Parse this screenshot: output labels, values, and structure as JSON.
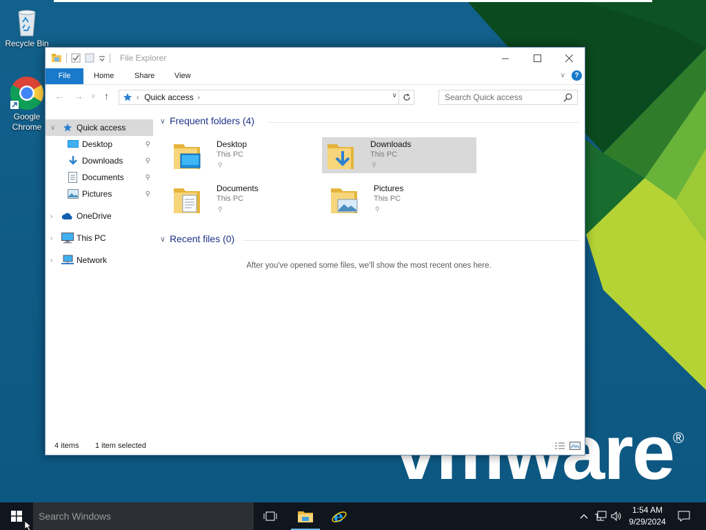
{
  "desktop": {
    "icons": [
      {
        "name": "recycle-bin",
        "label": "Recycle Bin"
      },
      {
        "name": "google-chrome",
        "label_line1": "Google",
        "label_line2": "Chrome"
      }
    ],
    "wallpaper_brand": "vmware",
    "wallpaper_brand_mark": "®",
    "colors": {
      "background": "#0f5f8a",
      "green_dark": "#0b4a1f",
      "green_mid": "#3d8c2a",
      "lime": "#b5d334"
    }
  },
  "explorer": {
    "title": "File Explorer",
    "ribbon": {
      "tabs": [
        "File",
        "Home",
        "Share",
        "View"
      ],
      "help": "?"
    },
    "address": {
      "location": "Quick access"
    },
    "search": {
      "placeholder": "Search Quick access"
    },
    "nav_pane": {
      "quick_access": "Quick access",
      "pinned": [
        "Desktop",
        "Downloads",
        "Documents",
        "Pictures"
      ],
      "onedrive": "OneDrive",
      "this_pc": "This PC",
      "network": "Network"
    },
    "frequent": {
      "heading": "Frequent folders (4)",
      "items": [
        {
          "name": "Desktop",
          "location": "This PC"
        },
        {
          "name": "Downloads",
          "location": "This PC"
        },
        {
          "name": "Documents",
          "location": "This PC"
        },
        {
          "name": "Pictures",
          "location": "This PC"
        }
      ]
    },
    "recent": {
      "heading": "Recent files (0)",
      "empty_message": "After you've opened some files, we'll show the most recent ones here."
    },
    "status": {
      "items": "4 items",
      "selected": "1 item selected"
    },
    "colors": {
      "accent": "#1979ca",
      "heading": "#1e3287",
      "selection": "#d9d9d9"
    }
  },
  "taskbar": {
    "search_placeholder": "Search Windows",
    "apps": [
      "task-view",
      "file-explorer",
      "internet-explorer"
    ],
    "active_app": "file-explorer",
    "clock": {
      "time": "1:54 AM",
      "date": "9/29/2024"
    }
  }
}
